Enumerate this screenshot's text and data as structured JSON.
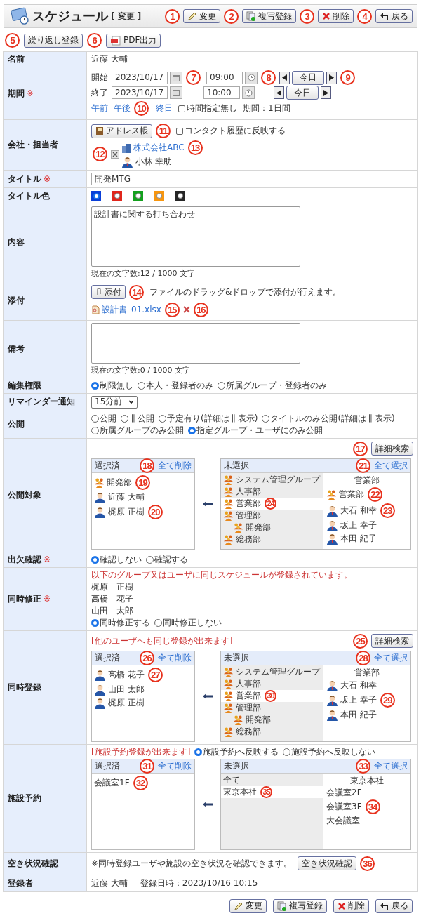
{
  "header": {
    "title": "スケジュール",
    "mode": "[ 変更 ]",
    "buttons": [
      {
        "label": "変更",
        "kind": "edit",
        "marker": "1"
      },
      {
        "label": "複写登録",
        "kind": "copy",
        "marker": "2"
      },
      {
        "label": "削除",
        "kind": "delete",
        "marker": "3"
      },
      {
        "label": "戻る",
        "kind": "back",
        "marker": "4"
      }
    ]
  },
  "toolbar": [
    {
      "label": "繰り返し登録",
      "kind": "plain",
      "marker": "5"
    },
    {
      "label": "PDF出力",
      "kind": "pdf",
      "marker": "6"
    }
  ],
  "rows": [
    {
      "kind": "text",
      "label": "名前",
      "value": "近藤 大輔"
    },
    {
      "kind": "period",
      "label": "期間",
      "required_mark": "※",
      "lines": [
        {
          "label": "開始",
          "date": "2023/10/17",
          "time": "09:00",
          "today": "今日",
          "date_marker": "7",
          "time_marker": "8",
          "today_marker": "9"
        },
        {
          "label": "終了",
          "date": "2023/10/17",
          "time": "10:00",
          "today": "今日"
        }
      ],
      "shortcuts": [
        {
          "label": "午前"
        },
        {
          "label": "午後",
          "marker": "10"
        },
        {
          "label": "終日"
        }
      ],
      "no_time": {
        "label": "時間指定無し",
        "checked": false
      },
      "duration": "期間：1日間"
    },
    {
      "kind": "company",
      "label": "会社・担当者",
      "address_button": {
        "label": "アドレス帳",
        "marker": "11"
      },
      "contact_history": {
        "label": "コンタクト履歴に反映する",
        "checked": false
      },
      "remove_marker": "12",
      "company": {
        "name": "株式会社ABC",
        "marker": "13"
      },
      "person": "小林 幸助"
    },
    {
      "kind": "input",
      "label": "タイトル",
      "required_mark": "※",
      "value": "開発MTG"
    },
    {
      "kind": "colors",
      "label": "タイトル色",
      "colors": [
        {
          "color": "#0a3fd8",
          "selected": true
        },
        {
          "color": "#e0261c",
          "selected": false
        },
        {
          "color": "#14a01e",
          "selected": false
        },
        {
          "color": "#f7960f",
          "selected": false
        },
        {
          "color": "#262626",
          "selected": false
        }
      ]
    },
    {
      "kind": "textarea",
      "label": "内容",
      "value": "設計書に関する打ち合わせ",
      "counter": "現在の文字数:12 / 1000 文字"
    },
    {
      "kind": "attach",
      "label": "添付",
      "button": {
        "label": "添付",
        "marker": "14"
      },
      "hint": "ファイルのドラッグ&ドロップで添付が行えます。",
      "file": {
        "name": "設計書_01.xlsx",
        "marker": "15"
      },
      "remove_marker": "16"
    },
    {
      "kind": "memo",
      "label": "備考",
      "counter": "現在の文字数:0 / 1000 文字"
    },
    {
      "kind": "radios",
      "label": "編集権限",
      "options": [
        {
          "label": "制限無し",
          "selected": true
        },
        {
          "label": "本人・登録者のみ",
          "selected": false
        },
        {
          "label": "所属グループ・登録者のみ",
          "selected": false
        }
      ]
    },
    {
      "kind": "select",
      "label": "リマインダー通知",
      "value": "15分前"
    },
    {
      "kind": "radios",
      "label": "公開",
      "options": [
        {
          "label": "公開",
          "selected": false
        },
        {
          "label": "非公開",
          "selected": false
        },
        {
          "label": "予定有り(詳細は非表示)",
          "selected": false
        },
        {
          "label": "タイトルのみ公開(詳細は非表示)",
          "selected": false
        },
        {
          "label": "所属グループのみ公開",
          "selected": false
        },
        {
          "label": "指定グループ・ユーザにのみ公開",
          "selected": true
        }
      ]
    },
    {
      "kind": "selector",
      "label": "公開対象",
      "search": {
        "label": "詳細検索",
        "marker": "17"
      },
      "selected_pane": {
        "title": "選択済",
        "action": {
          "label": "全て削除",
          "marker": "18"
        },
        "items": [
          {
            "kind": "group",
            "name": "開発部",
            "marker": "19"
          },
          {
            "kind": "user",
            "name": "近藤 大輔"
          },
          {
            "kind": "user",
            "name": "梶原 正樹",
            "marker": "20"
          }
        ]
      },
      "available_pane": {
        "title": "未選択",
        "action": {
          "label": "全て選択",
          "marker": "21"
        },
        "groups": [
          {
            "name": "システム管理グループ",
            "selected": false
          },
          {
            "name": "人事部",
            "selected": false
          },
          {
            "name": "営業部",
            "selected": true,
            "marker": "24"
          },
          {
            "name": "管理部",
            "selected": false,
            "children": [
              {
                "name": "開発部",
                "selected": false
              }
            ]
          },
          {
            "name": "総務部",
            "selected": false
          }
        ],
        "heading": "営業部",
        "items": [
          {
            "kind": "group",
            "name": "営業部",
            "marker": "22"
          },
          {
            "kind": "user",
            "name": "大石 和幸",
            "marker": "23"
          },
          {
            "kind": "user",
            "name": "坂上 幸子"
          },
          {
            "kind": "user",
            "name": "本田 紀子"
          }
        ]
      }
    },
    {
      "kind": "radios",
      "label": "出欠確認",
      "required_mark": "※",
      "options": [
        {
          "label": "確認しない",
          "selected": true
        },
        {
          "label": "確認する",
          "selected": false
        }
      ]
    },
    {
      "kind": "conflict",
      "label": "同時修正",
      "required_mark": "※",
      "message": "以下のグループ又はユーザに同じスケジュールが登録されています。",
      "names": [
        "梶原　正樹",
        "高橋　花子",
        "山田　太郎"
      ],
      "options": [
        {
          "label": "同時修正する",
          "selected": true
        },
        {
          "label": "同時修正しない",
          "selected": false
        }
      ]
    },
    {
      "kind": "selector",
      "label": "同時登録",
      "note": "[他のユーザへも同じ登録が出来ます]",
      "search": {
        "label": "詳細検索",
        "marker": "25"
      },
      "selected_pane": {
        "title": "選択済",
        "action": {
          "label": "全て削除",
          "marker": "26"
        },
        "items": [
          {
            "kind": "user",
            "name": "高橋 花子",
            "marker": "27"
          },
          {
            "kind": "user",
            "name": "山田 太郎"
          },
          {
            "kind": "user",
            "name": "梶原 正樹"
          }
        ]
      },
      "available_pane": {
        "title": "未選択",
        "action": {
          "label": "全て選択",
          "marker": "28"
        },
        "groups": [
          {
            "name": "システム管理グループ",
            "selected": false
          },
          {
            "name": "人事部",
            "selected": false
          },
          {
            "name": "営業部",
            "selected": true,
            "marker": "30"
          },
          {
            "name": "管理部",
            "selected": false,
            "children": [
              {
                "name": "開発部",
                "selected": false
              }
            ]
          },
          {
            "name": "総務部",
            "selected": false
          }
        ],
        "heading": "営業部",
        "items": [
          {
            "kind": "user",
            "name": "大石 和幸"
          },
          {
            "kind": "user",
            "name": "坂上 幸子",
            "marker": "29"
          },
          {
            "kind": "user",
            "name": "本田 紀子"
          }
        ]
      }
    },
    {
      "kind": "selector",
      "label": "施設予約",
      "note": "[施設予約登録が出来ます]",
      "options": [
        {
          "label": "施設予約へ反映する",
          "selected": true
        },
        {
          "label": "施設予約へ反映しない",
          "selected": false
        }
      ],
      "selected_pane": {
        "title": "選択済",
        "action": {
          "label": "全て削除",
          "marker": "31"
        },
        "items": [
          {
            "kind": "facility",
            "name": "会議室1F",
            "marker": "32"
          }
        ]
      },
      "available_pane": {
        "title": "未選択",
        "action": {
          "label": "全て選択",
          "marker": "33"
        },
        "groups": [
          {
            "name": "全て",
            "selected": false
          },
          {
            "name": "東京本社",
            "selected": true,
            "marker": "35"
          }
        ],
        "heading": "東京本社",
        "items": [
          {
            "kind": "facility",
            "name": "会議室2F"
          },
          {
            "kind": "facility",
            "name": "会議室3F",
            "marker": "34"
          },
          {
            "kind": "facility",
            "name": "大会議室"
          }
        ]
      }
    },
    {
      "kind": "availability",
      "label": "空き状況確認",
      "text": "※同時登録ユーザや施設の空き状況を確認できます。",
      "button": {
        "label": "空き状況確認",
        "marker": "36"
      }
    },
    {
      "kind": "registrant",
      "label": "登録者",
      "name": "近藤 大輔",
      "date": "登録日時：2023/10/16 10:15"
    }
  ],
  "footer_buttons": [
    {
      "label": "変更",
      "kind": "edit"
    },
    {
      "label": "複写登録",
      "kind": "copy"
    },
    {
      "label": "削除",
      "kind": "delete"
    },
    {
      "label": "戻る",
      "kind": "back"
    }
  ]
}
